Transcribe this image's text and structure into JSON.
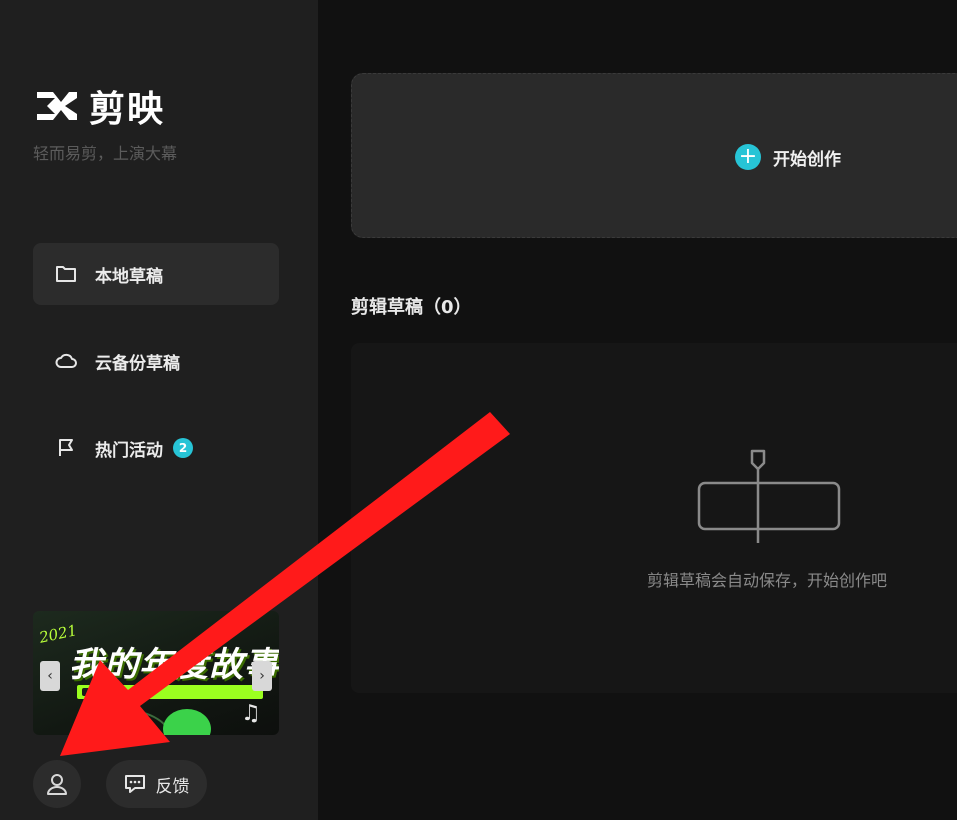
{
  "brand": {
    "name": "剪映",
    "slogan": "轻而易剪，上演大幕"
  },
  "sidebar": {
    "items": [
      {
        "label": "本地草稿",
        "icon": "folder-icon",
        "active": true
      },
      {
        "label": "云备份草稿",
        "icon": "cloud-icon",
        "active": false
      },
      {
        "label": "热门活动",
        "icon": "flag-icon",
        "active": false,
        "badge": "2"
      }
    ],
    "banner": {
      "year": "2021",
      "title": "我的年度故事",
      "prev": "‹",
      "next": "›"
    },
    "feedback_label": "反馈"
  },
  "main": {
    "create_label": "开始创作",
    "drafts_title": "剪辑草稿（0）",
    "empty_text": "剪辑草稿会自动保存，开始创作吧"
  },
  "colors": {
    "accent": "#27c4d6",
    "annotation": "#ff1a1a"
  }
}
